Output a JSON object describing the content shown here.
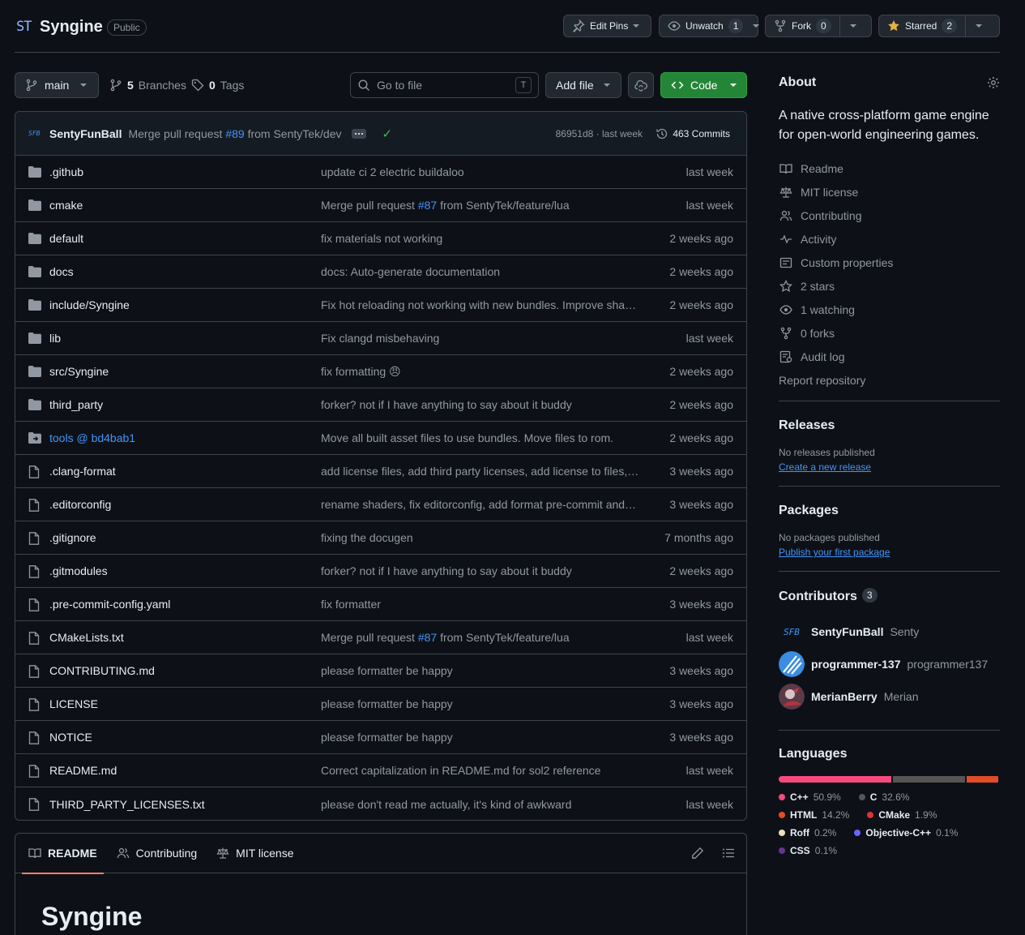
{
  "repo": {
    "logo_text": "ST",
    "name": "Syngine",
    "visibility": "Public",
    "actions": {
      "edit_pins": "Edit Pins",
      "unwatch": "Unwatch",
      "unwatch_count": "1",
      "fork": "Fork",
      "fork_count": "0",
      "starred": "Starred",
      "star_count": "2"
    }
  },
  "toolbar": {
    "branch": "main",
    "branches_count": "5",
    "branches_label": "Branches",
    "tags_count": "0",
    "tags_label": "Tags",
    "search_placeholder": "Go to file",
    "search_shortcut": "T",
    "add_file": "Add file",
    "code": "Code"
  },
  "latest_commit": {
    "avatar_text": "SFB",
    "author": "SentyFunBall",
    "message_prefix": "Merge pull request",
    "pr": "#89",
    "message_suffix": "from SentyTek/dev",
    "sha": "86951d8 · last week",
    "commits": "463 Commits"
  },
  "files": [
    {
      "name": ".github",
      "type": "dir",
      "message": "update ci 2 electric buildaloo",
      "date": "last week"
    },
    {
      "name": "cmake",
      "type": "dir",
      "message_prefix": "Merge pull request",
      "pr": "#87",
      "message_suffix": "from SentyTek/feature/lua",
      "date": "last week"
    },
    {
      "name": "default",
      "type": "dir",
      "message": "fix materials not working",
      "date": "2 weeks ago"
    },
    {
      "name": "docs",
      "type": "dir",
      "message": "docs: Auto-generate documentation",
      "date": "2 weeks ago"
    },
    {
      "name": "include/Syngine",
      "type": "dir",
      "message": "Fix hot reloading not working with new bundles. Improve sha…",
      "date": "2 weeks ago"
    },
    {
      "name": "lib",
      "type": "dir",
      "message": "Fix clangd misbehaving",
      "date": "last week"
    },
    {
      "name": "src/Syngine",
      "type": "dir",
      "message": "fix formatting",
      "emoji": "😠",
      "date": "2 weeks ago"
    },
    {
      "name": "third_party",
      "type": "dir",
      "message": "forker? not if I have anything to say about it buddy",
      "date": "2 weeks ago"
    },
    {
      "name": "tools @ bd4bab1",
      "type": "submodule",
      "message": "Move all built asset files to use bundles. Move files to rom.",
      "date": "2 weeks ago"
    },
    {
      "name": ".clang-format",
      "type": "file",
      "message": "add license files, add third party licenses, add license to files, …",
      "date": "3 weeks ago"
    },
    {
      "name": ".editorconfig",
      "type": "file",
      "message": "rename shaders, fix editorconfig, add format pre-commit and…",
      "date": "3 weeks ago"
    },
    {
      "name": ".gitignore",
      "type": "file",
      "message": "fixing the docugen",
      "date": "7 months ago"
    },
    {
      "name": ".gitmodules",
      "type": "file",
      "message": "forker? not if I have anything to say about it buddy",
      "date": "2 weeks ago"
    },
    {
      "name": ".pre-commit-config.yaml",
      "type": "file",
      "message": "fix formatter",
      "date": "3 weeks ago"
    },
    {
      "name": "CMakeLists.txt",
      "type": "file",
      "message_prefix": "Merge pull request",
      "pr": "#87",
      "message_suffix": "from SentyTek/feature/lua",
      "date": "last week"
    },
    {
      "name": "CONTRIBUTING.md",
      "type": "file",
      "message": "please formatter be happy",
      "date": "3 weeks ago"
    },
    {
      "name": "LICENSE",
      "type": "file",
      "message": "please formatter be happy",
      "date": "3 weeks ago"
    },
    {
      "name": "NOTICE",
      "type": "file",
      "message": "please formatter be happy",
      "date": "3 weeks ago"
    },
    {
      "name": "README.md",
      "type": "file",
      "message": "Correct capitalization in README.md for sol2 reference",
      "date": "last week"
    },
    {
      "name": "THIRD_PARTY_LICENSES.txt",
      "type": "file",
      "message": "please don't read me actually, it's kind of awkward",
      "date": "last week"
    }
  ],
  "readme": {
    "tabs": [
      "README",
      "Contributing",
      "MIT license"
    ],
    "title": "Syngine"
  },
  "about": {
    "heading": "About",
    "description": "A native cross-platform game engine for open-world engineering games.",
    "links": [
      {
        "icon": "book-icon",
        "label": "Readme"
      },
      {
        "icon": "scale-icon",
        "label": "MIT license"
      },
      {
        "icon": "people-icon",
        "label": "Contributing"
      },
      {
        "icon": "pulse-icon",
        "label": "Activity"
      },
      {
        "icon": "note-icon",
        "label": "Custom properties"
      },
      {
        "icon": "star-icon",
        "label": "2 stars"
      },
      {
        "icon": "eye-icon",
        "label": "1 watching"
      },
      {
        "icon": "fork-icon",
        "label": "0 forks"
      },
      {
        "icon": "log-icon",
        "label": "Audit log"
      },
      {
        "icon": "",
        "label": "Report repository"
      }
    ]
  },
  "releases": {
    "heading": "Releases",
    "status": "No releases published",
    "link": "Create a new release"
  },
  "packages": {
    "heading": "Packages",
    "status": "No packages published",
    "link": "Publish your first package"
  },
  "contributors": {
    "heading": "Contributors",
    "count": "3",
    "people": [
      {
        "avatar": "SFB",
        "login": "SentyFunBall",
        "name": "Senty"
      },
      {
        "avatar": "",
        "login": "programmer-137",
        "name": "programmer137"
      },
      {
        "avatar": "",
        "login": "MerianBerry",
        "name": "Merian"
      }
    ]
  },
  "languages": {
    "heading": "Languages",
    "items": [
      {
        "name": "C++",
        "percent": "50.9%",
        "value": 50.9,
        "color": "#f34b7d"
      },
      {
        "name": "C",
        "percent": "32.6%",
        "value": 32.6,
        "color": "#555555"
      },
      {
        "name": "HTML",
        "percent": "14.2%",
        "value": 14.2,
        "color": "#e34c26"
      },
      {
        "name": "CMake",
        "percent": "1.9%",
        "value": 1.9,
        "color": "#da3434"
      },
      {
        "name": "Roff",
        "percent": "0.2%",
        "value": 0.2,
        "color": "#ecdebe"
      },
      {
        "name": "Objective-C++",
        "percent": "0.1%",
        "value": 0.1,
        "color": "#6866fb"
      },
      {
        "name": "CSS",
        "percent": "0.1%",
        "value": 0.1,
        "color": "#663399"
      }
    ]
  }
}
